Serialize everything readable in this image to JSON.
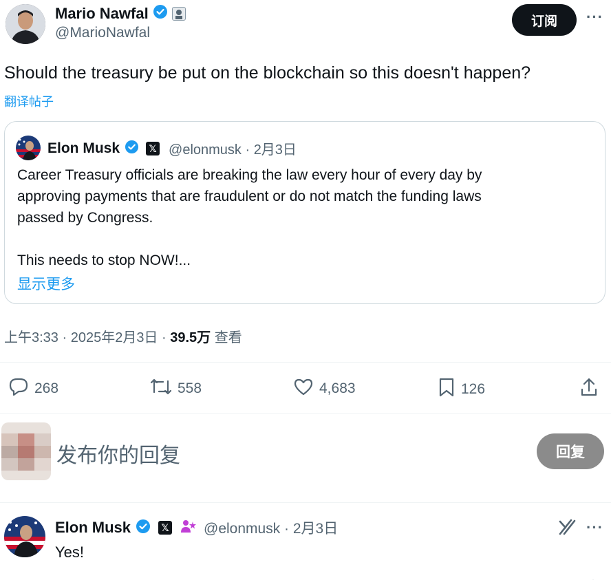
{
  "post": {
    "author_name": "Mario Nawfal",
    "author_handle": "@MarioNawfal",
    "subscribe_label": "订阅",
    "more": "···",
    "text": "Should the treasury be put on the blockchain so this doesn't happen?",
    "translate": "翻译帖子",
    "time": "上午3:33 · 2025年2月3日 · ",
    "views_count": "39.5万",
    "views_label": " 查看"
  },
  "quote": {
    "author_name": "Elon Musk",
    "handle_date": "@elonmusk · 2月3日",
    "line1": "Career Treasury officials are breaking the law every hour of every day by",
    "line2": "approving payments that are fraudulent or do not match the funding laws",
    "line3": "passed by Congress.",
    "line4": "This needs to stop NOW!...",
    "show_more": "显示更多"
  },
  "actions": {
    "replies": "268",
    "reposts": "558",
    "likes": "4,683",
    "bookmarks": "126"
  },
  "composer": {
    "placeholder": "发布你的回复",
    "reply_button": "回复"
  },
  "reply": {
    "author_name": "Elon Musk",
    "handle_date": "@elonmusk · 2月3日",
    "text": "Yes!",
    "more": "···"
  },
  "colors": {
    "accent": "#1d9bf0",
    "verified": "#1d9bf0",
    "text": "#0f1419",
    "muted": "#536471",
    "subscribe_bg": "#0f1419",
    "reply_button_bg": "#8b8b8b"
  }
}
